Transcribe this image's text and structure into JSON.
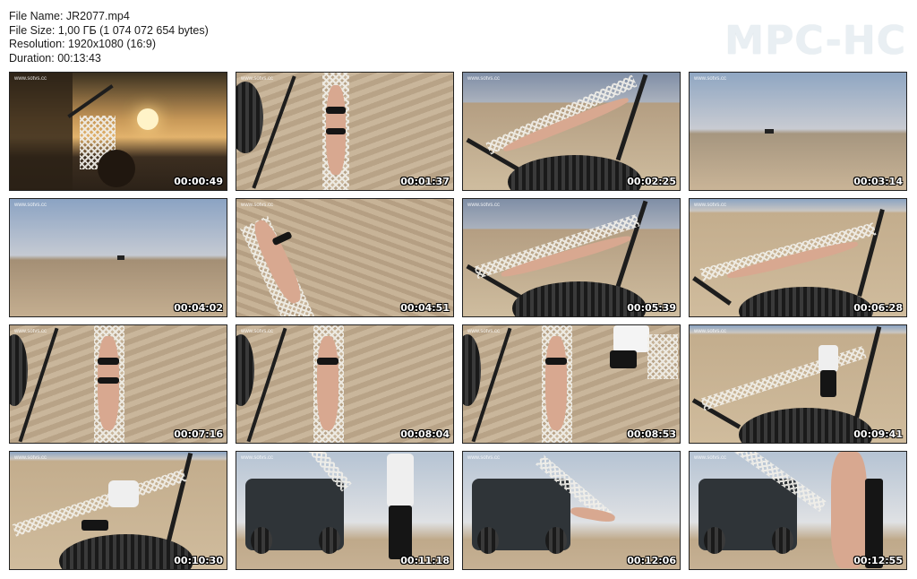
{
  "file_info": {
    "name_line": "File Name: JR2077.mp4",
    "size_line": "File Size: 1,00 ГБ (1 074 072 654 bytes)",
    "resolution_line": "Resolution: 1920x1080 (16:9)",
    "duration_line": "Duration: 00:13:43"
  },
  "logo": "MPC-HC",
  "watermark": "www.sotvs.cc",
  "thumbnails": [
    {
      "time": "00:00:49"
    },
    {
      "time": "00:01:37"
    },
    {
      "time": "00:02:25"
    },
    {
      "time": "00:03:14"
    },
    {
      "time": "00:04:02"
    },
    {
      "time": "00:04:51"
    },
    {
      "time": "00:05:39"
    },
    {
      "time": "00:06:28"
    },
    {
      "time": "00:07:16"
    },
    {
      "time": "00:08:04"
    },
    {
      "time": "00:08:53"
    },
    {
      "time": "00:09:41"
    },
    {
      "time": "00:10:30"
    },
    {
      "time": "00:11:18"
    },
    {
      "time": "00:12:06"
    },
    {
      "time": "00:12:55"
    }
  ]
}
